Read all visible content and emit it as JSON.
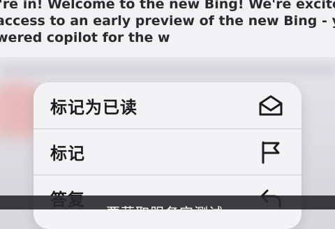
{
  "email_preview": {
    "lines": [
      "'re in! Welcome to the new Bing! We're excited to g",
      " access to an early preview of the new Bing - your",
      "wered copilot for the w"
    ]
  },
  "context_menu": {
    "items": [
      {
        "label": "标记为已读",
        "icon": "envelope-open-icon"
      },
      {
        "label": "标记",
        "icon": "flag-icon"
      },
      {
        "label": "答复",
        "icon": "reply-arrow-icon"
      }
    ]
  },
  "toast": {
    "text": "要获取服务实测试"
  },
  "colors": {
    "menu_bg": "#f4f4f6",
    "text": "#1b1b1d",
    "toast_bg": "#28282c",
    "toast_text": "#ffffff"
  }
}
